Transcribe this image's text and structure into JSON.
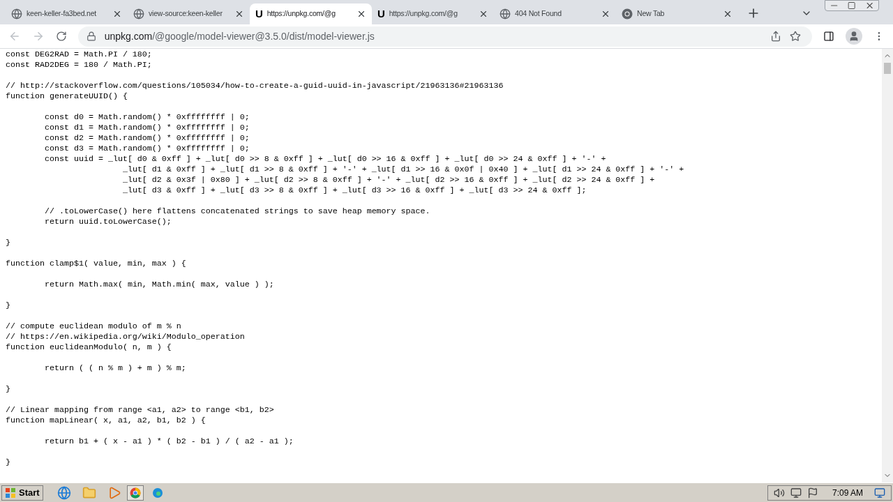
{
  "browser": {
    "tabs": [
      {
        "title": "keen-keller-fa3bed.net",
        "favicon": {
          "kind": "globe"
        },
        "selected": false
      },
      {
        "title": "view-source:keen-keller",
        "favicon": {
          "kind": "globe"
        },
        "selected": false
      },
      {
        "title": "https://unpkg.com/@g",
        "favicon": {
          "kind": "letter",
          "text": "U"
        },
        "selected": true
      },
      {
        "title": "https://unpkg.com/@g",
        "favicon": {
          "kind": "letter",
          "text": "U"
        },
        "selected": false
      },
      {
        "title": "404 Not Found",
        "favicon": {
          "kind": "globe"
        },
        "selected": false
      },
      {
        "title": "New Tab",
        "favicon": {
          "kind": "chrome"
        },
        "selected": false
      }
    ],
    "address": {
      "host": "unpkg.com",
      "path": "/@google/model-viewer@3.5.0/dist/model-viewer.js"
    }
  },
  "code": {
    "paragraphs": [
      [
        "const DEG2RAD = Math.PI / 180;",
        "const RAD2DEG = 180 / Math.PI;"
      ],
      [
        "// http://stackoverflow.com/questions/105034/how-to-create-a-guid-uuid-in-javascript/21963136#21963136",
        "function generateUUID() {"
      ],
      [
        "\tconst d0 = Math.random() * 0xffffffff | 0;",
        "\tconst d1 = Math.random() * 0xffffffff | 0;",
        "\tconst d2 = Math.random() * 0xffffffff | 0;",
        "\tconst d3 = Math.random() * 0xffffffff | 0;",
        "\tconst uuid = _lut[ d0 & 0xff ] + _lut[ d0 >> 8 & 0xff ] + _lut[ d0 >> 16 & 0xff ] + _lut[ d0 >> 24 & 0xff ] + '-' +",
        "\t\t\t_lut[ d1 & 0xff ] + _lut[ d1 >> 8 & 0xff ] + '-' + _lut[ d1 >> 16 & 0x0f | 0x40 ] + _lut[ d1 >> 24 & 0xff ] + '-' +",
        "\t\t\t_lut[ d2 & 0x3f | 0x80 ] + _lut[ d2 >> 8 & 0xff ] + '-' + _lut[ d2 >> 16 & 0xff ] + _lut[ d2 >> 24 & 0xff ] +",
        "\t\t\t_lut[ d3 & 0xff ] + _lut[ d3 >> 8 & 0xff ] + _lut[ d3 >> 16 & 0xff ] + _lut[ d3 >> 24 & 0xff ];"
      ],
      [
        "\t// .toLowerCase() here flattens concatenated strings to save heap memory space.",
        "\treturn uuid.toLowerCase();"
      ],
      [
        "}"
      ],
      [
        "function clamp$1( value, min, max ) {"
      ],
      [
        "\treturn Math.max( min, Math.min( max, value ) );"
      ],
      [
        "}"
      ],
      [
        "// compute euclidean modulo of m % n",
        "// https://en.wikipedia.org/wiki/Modulo_operation",
        "function euclideanModulo( n, m ) {"
      ],
      [
        "\treturn ( ( n % m ) + m ) % m;"
      ],
      [
        "}"
      ],
      [
        "// Linear mapping from range <a1, a2> to range <b1, b2>",
        "function mapLinear( x, a1, a2, b1, b2 ) {"
      ],
      [
        "\treturn b1 + ( x - a1 ) * ( b2 - b1 ) / ( a2 - a1 );"
      ],
      [
        "}"
      ]
    ]
  },
  "taskbar": {
    "start": "Start",
    "clock": "7:09 AM"
  }
}
